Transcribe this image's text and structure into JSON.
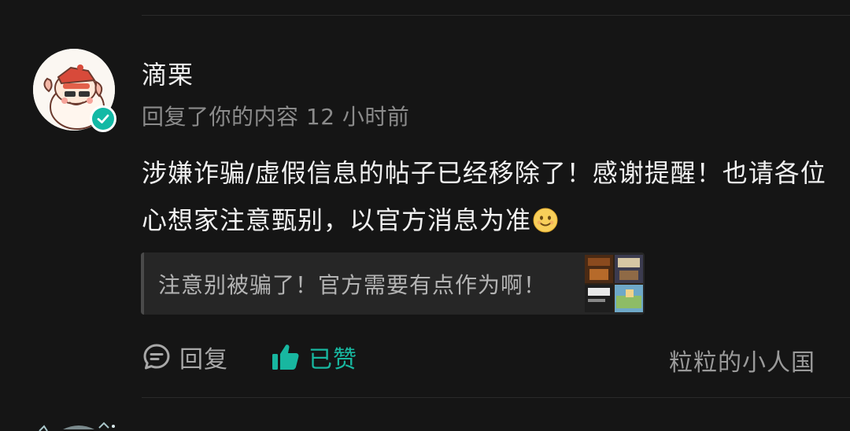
{
  "comment": {
    "username": "滴栗",
    "meta": "回复了你的内容 12 小时前",
    "content": "涉嫌诈骗/虚假信息的帖子已经移除了！感谢提醒！也请各位心想家注意甄别，以官方消息为准",
    "emoji": "smiling-face-emoji",
    "quote": {
      "text": "注意别被骗了！官方需要有点作为啊！"
    },
    "actions": {
      "reply_label": "回复",
      "like_label": "已赞",
      "source": "粒粒的小人国"
    }
  },
  "colors": {
    "background": "#151515",
    "accent": "#18b7a0",
    "verify_badge": "#13b9a5",
    "primary_text": "#f1f1f1",
    "secondary_text": "#8b8b8b"
  },
  "icons": {
    "reply": "reply-bubble-icon",
    "like": "thumbs-up-icon",
    "verify": "verified-check-icon"
  }
}
